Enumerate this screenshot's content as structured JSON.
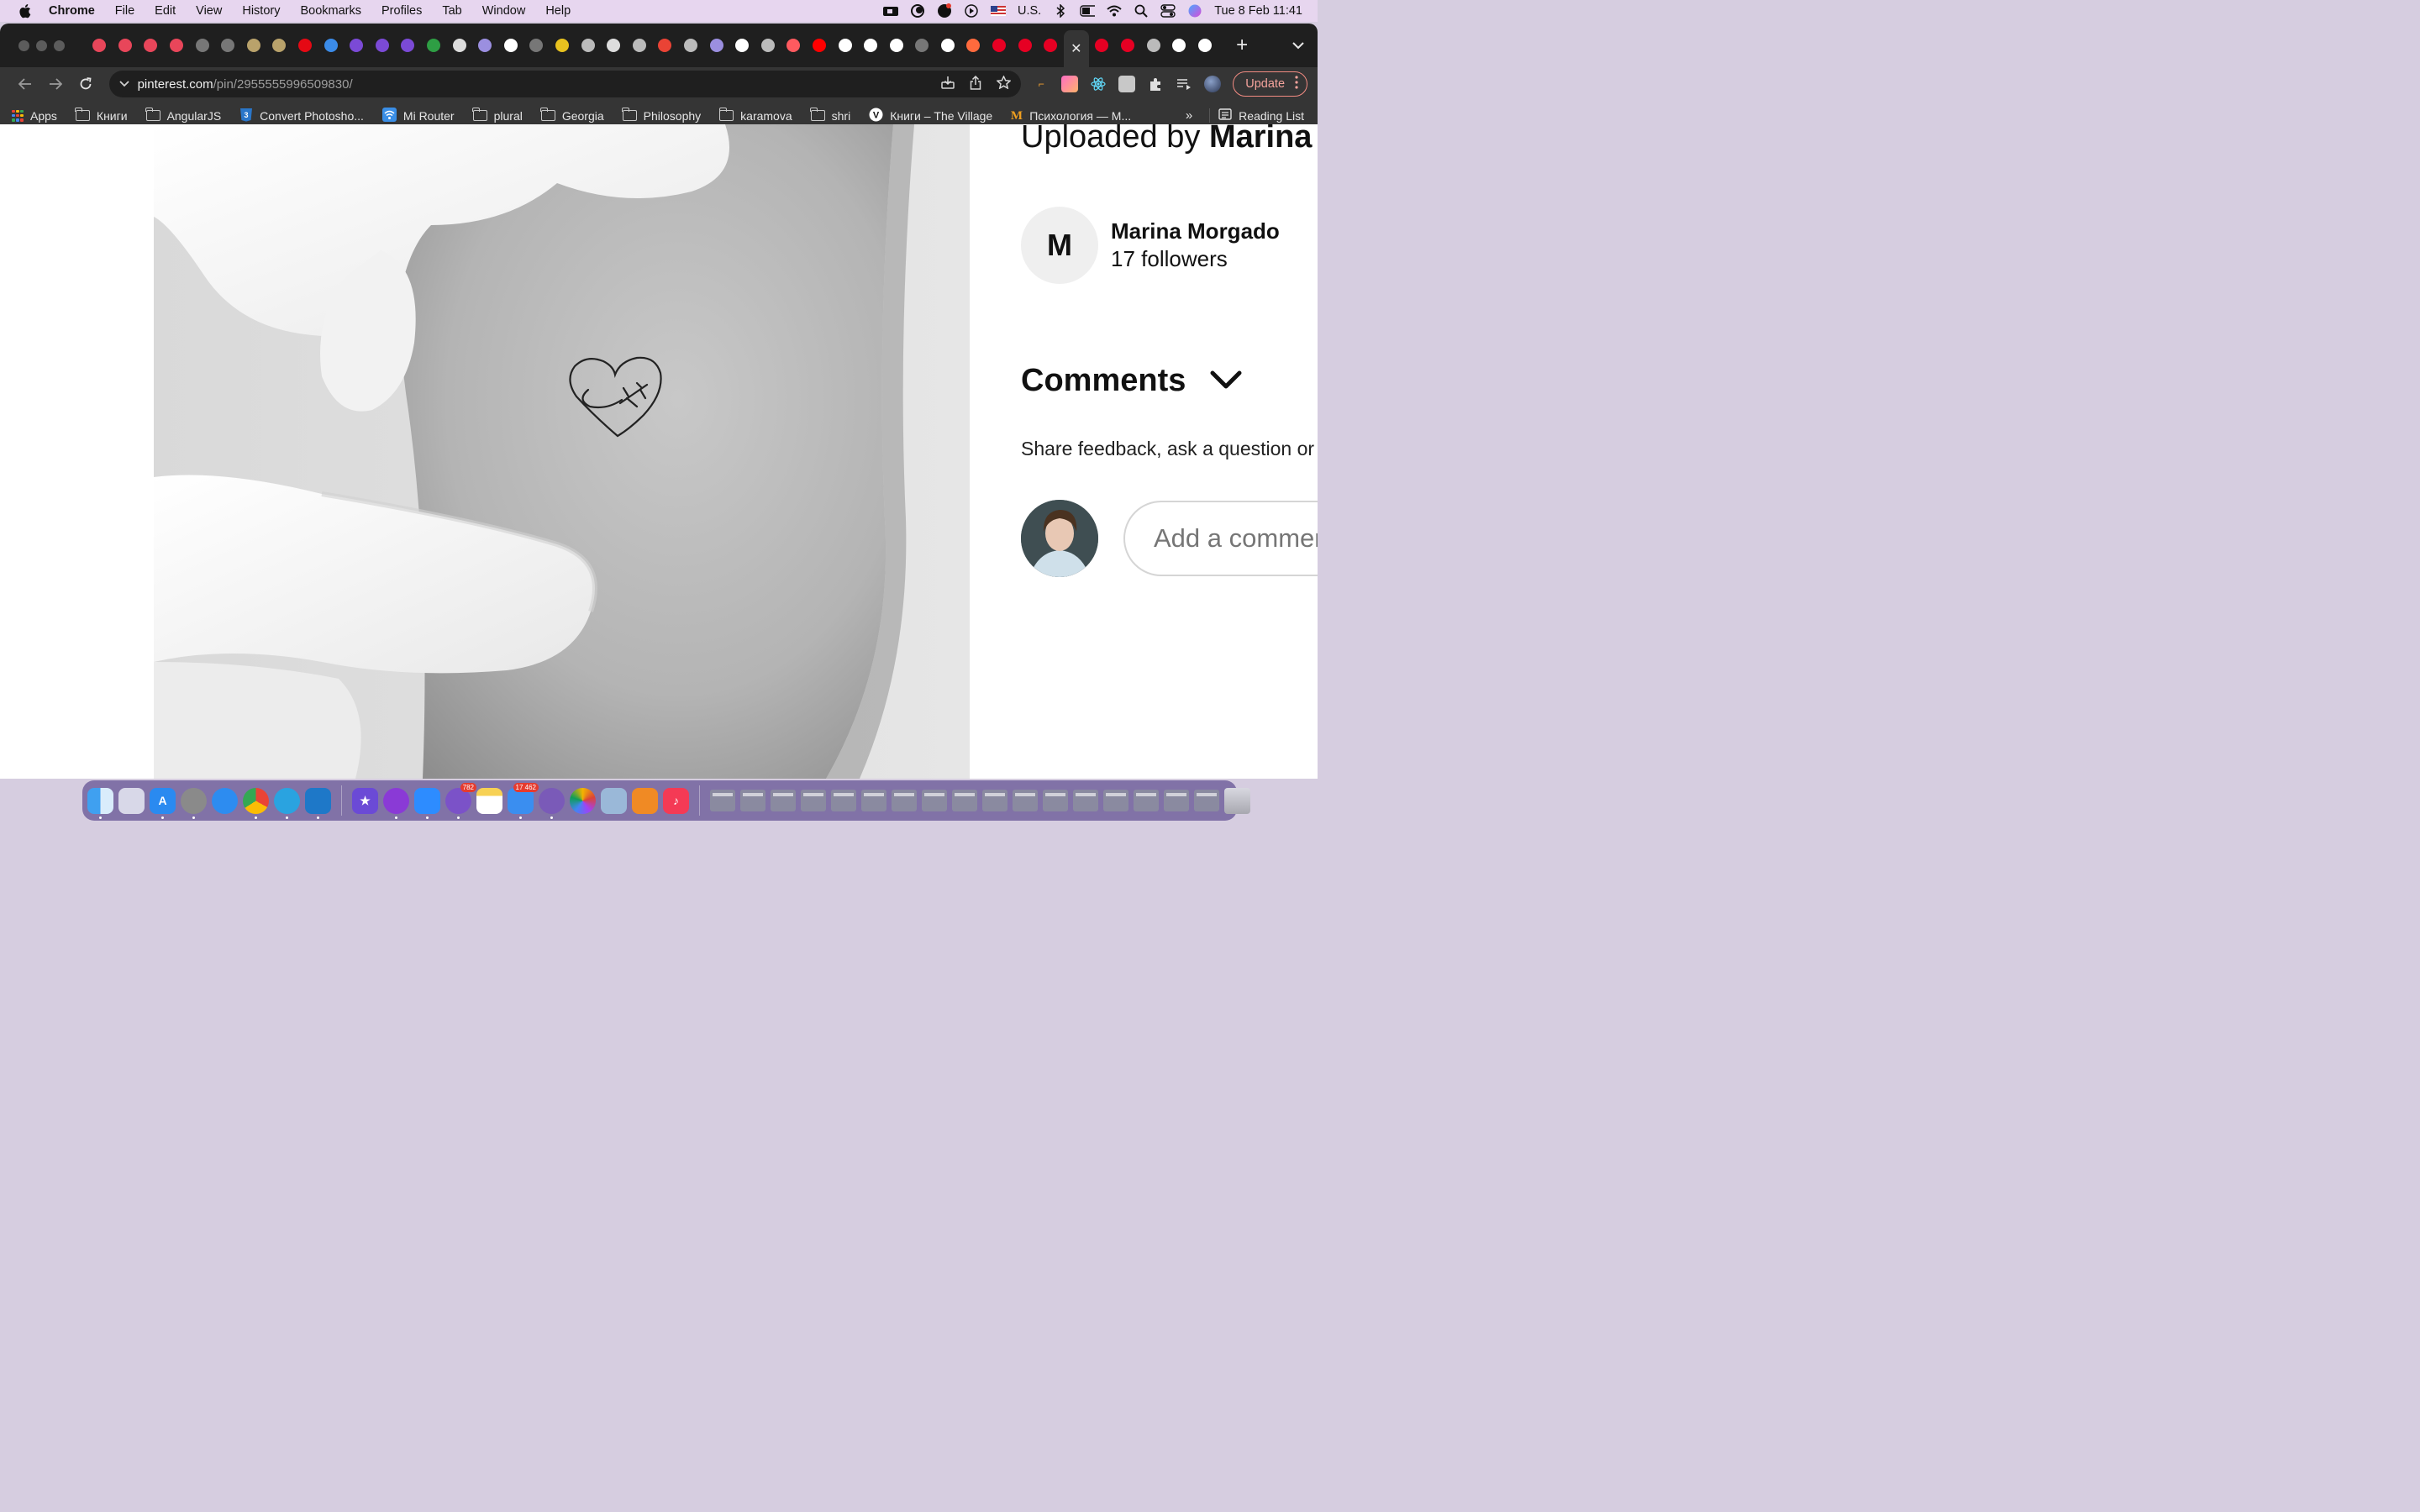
{
  "menubar": {
    "app_name": "Chrome",
    "items": [
      "File",
      "Edit",
      "View",
      "History",
      "Bookmarks",
      "Profiles",
      "Tab",
      "Window",
      "Help"
    ],
    "input_source": "U.S.",
    "clock": "Tue 8 Feb  11:41"
  },
  "browser": {
    "url_host": "pinterest.com",
    "url_path": "/pin/2955555996509830/",
    "update_label": "Update",
    "tab_favicons": [
      "#e8465a",
      "#e8465a",
      "#e8465a",
      "#e8465a",
      "#777",
      "#777",
      "#b9a26b",
      "#b9a26b",
      "#e50914",
      "#3b8be8",
      "#7b4ad6",
      "#7b4ad6",
      "#7b4ad6",
      "#2e9e44",
      "#ddd",
      "#9b8fe0",
      "#fff",
      "#777",
      "#e8c21f",
      "#bbb",
      "#ddd",
      "#bbb",
      "#ea4335",
      "#bbb",
      "#9b8fe0",
      "#fff",
      "#bbb",
      "#ff5a5f",
      "#ff0000",
      "#fff",
      "#fff",
      "#fff",
      "#777",
      "#fff",
      "#ff6a3d",
      "#e60023",
      "#e60023",
      "#e60023",
      "#e60023",
      "#e60023",
      "#bbb",
      "#fff",
      "#fff"
    ],
    "bookmarks": [
      {
        "label": "Apps",
        "icon": "apps-grid-icon"
      },
      {
        "label": "Книги",
        "icon": "folder-icon"
      },
      {
        "label": "AngularJS",
        "icon": "folder-icon"
      },
      {
        "label": "Convert Photosho...",
        "icon": "css3-icon"
      },
      {
        "label": "Mi Router",
        "icon": "wifi-icon"
      },
      {
        "label": "plural",
        "icon": "folder-icon"
      },
      {
        "label": "Georgia",
        "icon": "folder-icon"
      },
      {
        "label": "Philosophy",
        "icon": "folder-icon"
      },
      {
        "label": "karamova",
        "icon": "folder-icon"
      },
      {
        "label": "shri",
        "icon": "folder-icon"
      },
      {
        "label": "Книги – The Village",
        "icon": "village-icon"
      },
      {
        "label": "Психология — М...",
        "icon": "m-logo-icon"
      }
    ],
    "bookmarks_more": "»",
    "reading_list": "Reading List"
  },
  "pin": {
    "uploaded_prefix": "Uploaded by ",
    "uploaded_name": "Marina Morgado",
    "owner_initial": "M",
    "owner_name": "Marina Morgado",
    "owner_followers": "17 followers",
    "comments_title": "Comments",
    "comments_help": "Share feedback, ask a question or give a high five",
    "comment_placeholder": "Add a comment"
  },
  "dock": {
    "mail_badge": "17 462",
    "viber_badge": "782"
  },
  "colors": {
    "pinterest_red": "#e60023",
    "update_border": "#f28b82"
  }
}
